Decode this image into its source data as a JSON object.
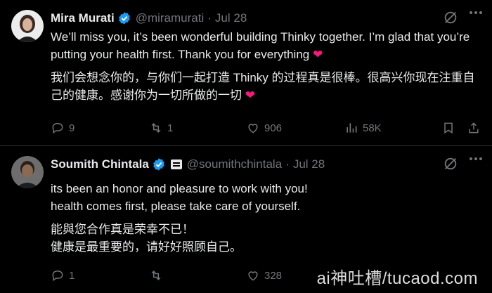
{
  "tweets": [
    {
      "author": "Mira Murati",
      "handle": "@miramurati",
      "sep": "·",
      "date": "Jul 28",
      "text_en": "We’ll miss you, it’s been wonderful building Thinky together. I’m glad that you’re putting your health first. Thank you for everything",
      "text_zh": "我们会想念你的，与你们一起打造 Thinky 的过程真是很棒。很高兴你现在注重自己的健康。感谢你为一切所做的一切",
      "replies": "9",
      "reposts": "1",
      "likes": "906",
      "views": "58K",
      "heart_emoji": "❤"
    },
    {
      "author": "Soumith Chintala",
      "handle": "@soumithchintala",
      "sep": "·",
      "date": "Jul 28",
      "text_en_1": "its been an honor and pleasure to work with you!",
      "text_en_2": "health comes first, please take care of yourself.",
      "text_zh_1": "能與您合作真是荣幸不已！",
      "text_zh_2": "健康是最重要的，请好好照顾自己。",
      "replies": "1",
      "reposts": "",
      "likes": "328",
      "views": ""
    }
  ],
  "watermark": "ai神吐槽/tucaod.com",
  "colors": {
    "background": "#000000",
    "text": "#e7e9ea",
    "muted": "#71767b",
    "verified": "#1d9bf0",
    "heart": "#f91880"
  },
  "icons": [
    "verified-badge-icon",
    "grok-icon",
    "more-icon",
    "reply-icon",
    "repost-icon",
    "like-icon",
    "views-icon",
    "bookmark-icon",
    "share-icon",
    "id-card-icon"
  ]
}
